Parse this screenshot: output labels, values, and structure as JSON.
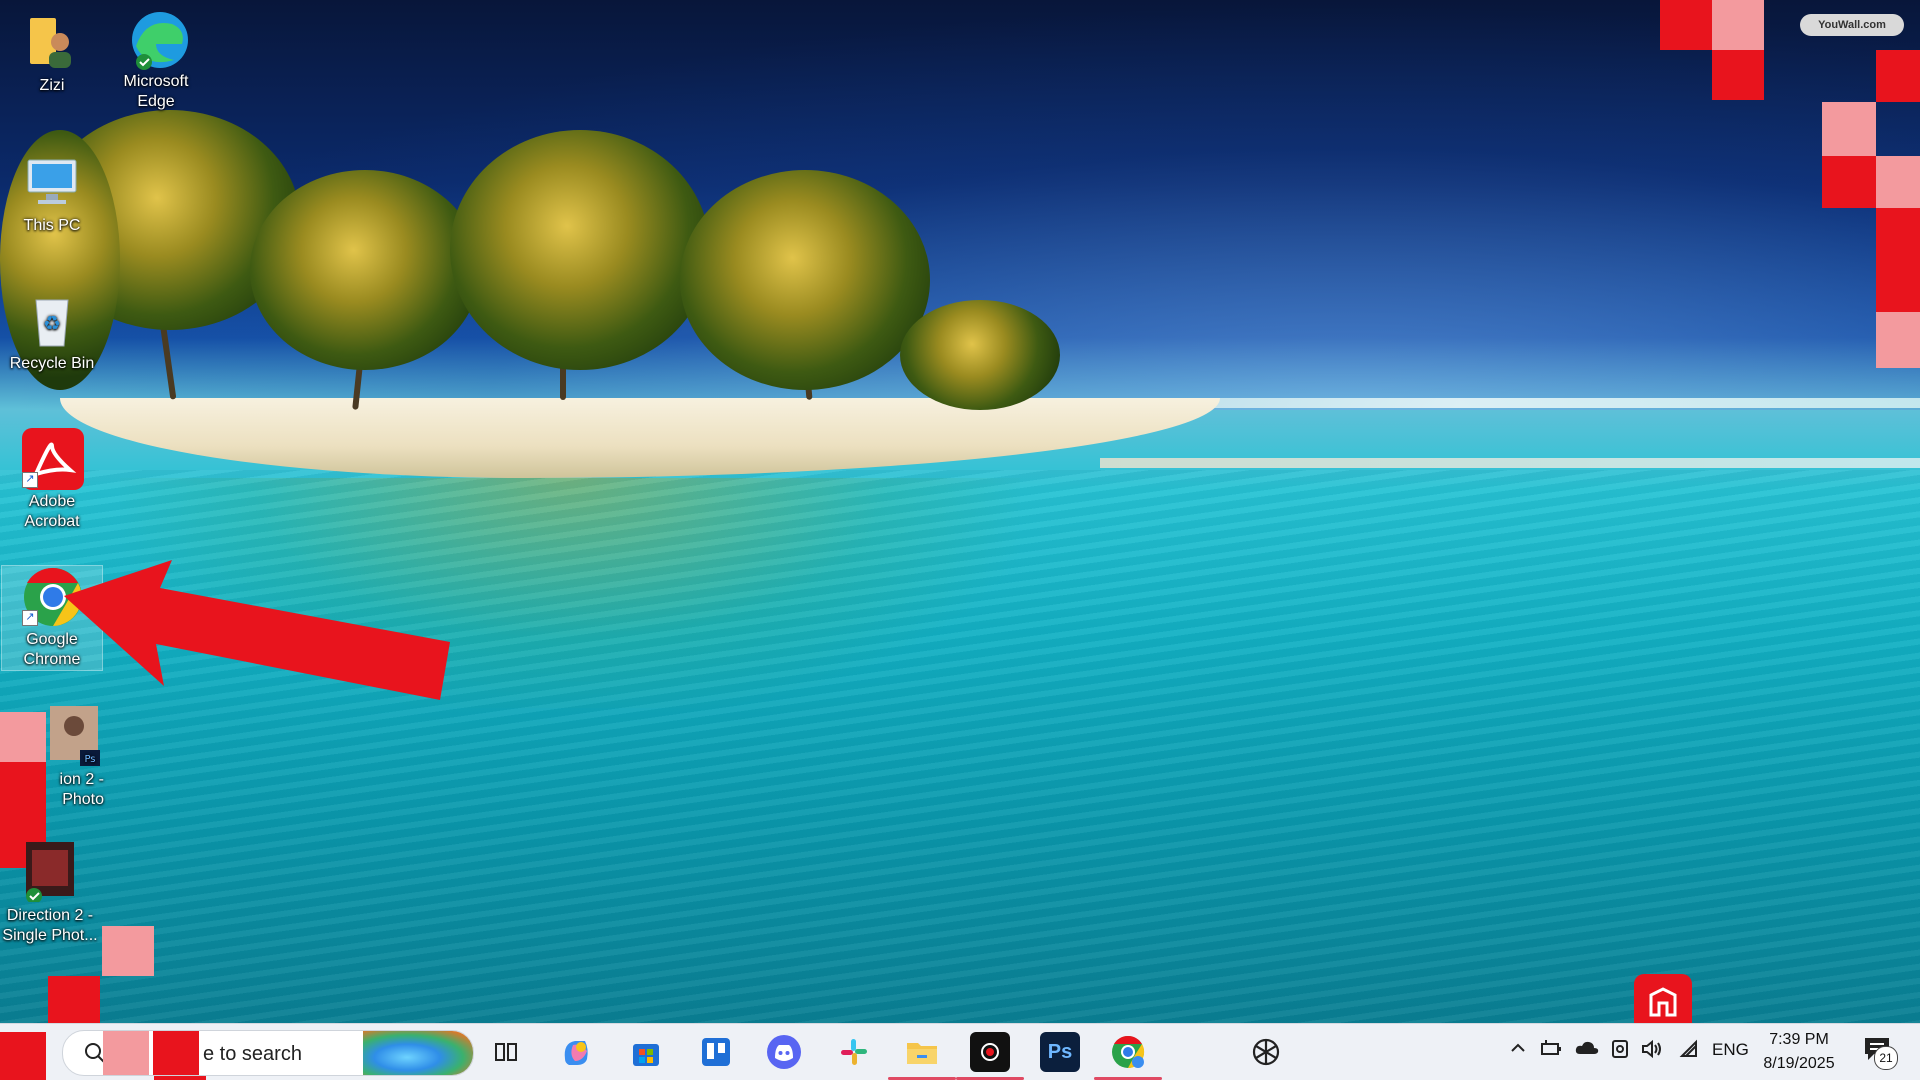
{
  "watermark": "YouWall.com",
  "desktop_icons": [
    {
      "label": "Zizi"
    },
    {
      "label": "Microsoft Edge"
    },
    {
      "label": "This PC"
    },
    {
      "label": "Recycle Bin"
    },
    {
      "label": "Adobe Acrobat"
    },
    {
      "label": "Google Chrome"
    },
    {
      "label": "ion 2 - Photo"
    },
    {
      "label": "Direction 2 - Single Phot..."
    }
  ],
  "taskbar": {
    "search_placeholder": "e to search",
    "pinned_apps": [
      "Task View",
      "Copilot",
      "Microsoft Store",
      "Trello",
      "Discord",
      "Slack",
      "File Explorer",
      "Recorder",
      "Photoshop",
      "Google Chrome",
      "ChatGPT"
    ],
    "photoshop_label": "Ps",
    "tray": {
      "language": "ENG",
      "time": "7:39 PM",
      "date": "8/19/2025",
      "notification_count": "21"
    }
  },
  "colors": {
    "annotation_red": "#e8141d",
    "pixel_pink": "#f39a9e",
    "taskbar_bg": "#eef1f6"
  }
}
